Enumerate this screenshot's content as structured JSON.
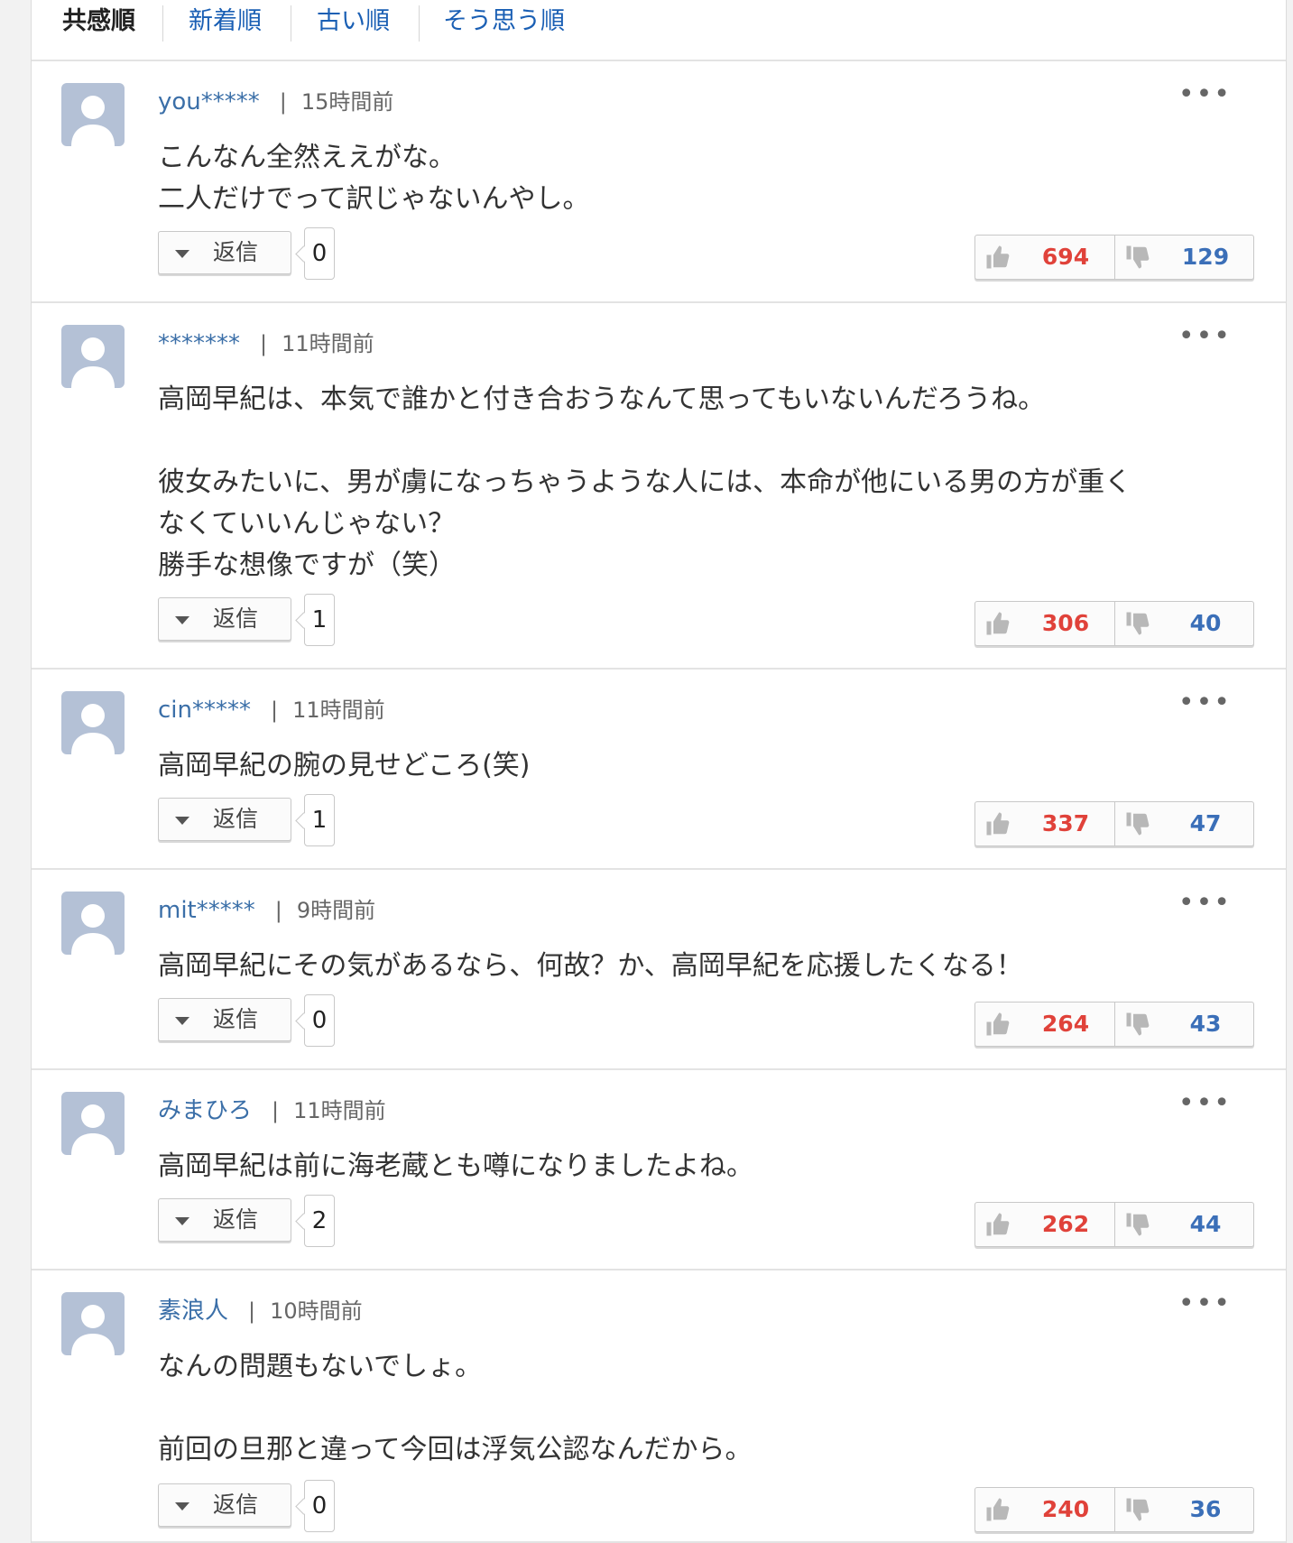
{
  "sort_tabs": [
    "共感順",
    "新着順",
    "古い順",
    "そう思う順"
  ],
  "reply_label": "返信",
  "more_label": "•••",
  "divider": "|",
  "comments": [
    {
      "author": "you*****",
      "time": "15時間前",
      "text": "こんなん全然ええがな。\n二人だけでって訳じゃないんやし。",
      "replies": "0",
      "likes": "694",
      "dislikes": "129"
    },
    {
      "author": "*******",
      "time": "11時間前",
      "text": "高岡早紀は、本気で誰かと付き合おうなんて思ってもいないんだろうね。\n\n彼女みたいに、男が虜になっちゃうような人には、本命が他にいる男の方が重く\nなくていいんじゃない？\n勝手な想像ですが（笑）",
      "replies": "1",
      "likes": "306",
      "dislikes": "40"
    },
    {
      "author": "cin*****",
      "time": "11時間前",
      "text": "高岡早紀の腕の見せどころ(笑)",
      "replies": "1",
      "likes": "337",
      "dislikes": "47"
    },
    {
      "author": "mit*****",
      "time": "9時間前",
      "text": "高岡早紀にその気があるなら、何故？か、高岡早紀を応援したくなる！",
      "replies": "0",
      "likes": "264",
      "dislikes": "43"
    },
    {
      "author": "みまひろ",
      "time": "11時間前",
      "text": "高岡早紀は前に海老蔵とも噂になりましたよね。",
      "replies": "2",
      "likes": "262",
      "dislikes": "44"
    },
    {
      "author": "素浪人",
      "time": "10時間前",
      "text": "なんの問題もないでしょ。\n\n前回の旦那と違って今回は浮気公認なんだから。",
      "replies": "0",
      "likes": "240",
      "dislikes": "36"
    }
  ],
  "colors": {
    "link": "#1a5fb4",
    "author": "#3b6fa8",
    "like": "#e0423a",
    "dislike": "#3b6fb8",
    "avatar": "#b4c1d6"
  }
}
